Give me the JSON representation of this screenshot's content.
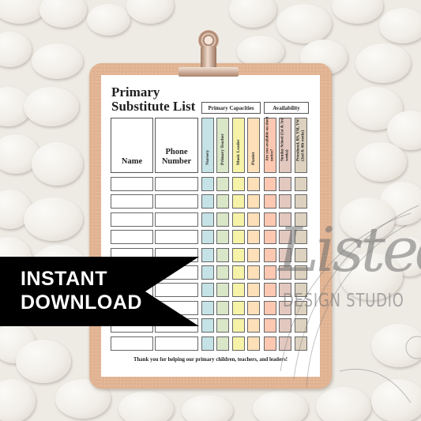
{
  "document": {
    "title_line1": "Primary",
    "title_line2": "Substitute List",
    "groups": {
      "capacities": "Primary Capacities",
      "availability": "Availability"
    },
    "headers": {
      "name": "Name",
      "phone_line1": "Phone",
      "phone_line2": "Number"
    },
    "columns": [
      {
        "label": "Nursery",
        "color": "#c5e3e6"
      },
      {
        "label": "Primary Teacher",
        "color": "#d9e6c8"
      },
      {
        "label": "Music Leader",
        "color": "#f6f3a9"
      },
      {
        "label": "Pianist",
        "color": "#fde0b8"
      },
      {
        "label": "Are you available on short notice?",
        "color": "#fdc8b2"
      },
      {
        "label": "Sunday School (1st & 3rd weeks)",
        "color": "#e2c8bf"
      },
      {
        "label": "Priesthood, RS, YM, YW (2nd & 4th weeks)",
        "color": "#ddd2c0"
      }
    ],
    "row_count": 10,
    "footer": "Thank you for helping our primary children, teachers, and leaders!"
  },
  "banner": {
    "line1": "INSTANT",
    "line2": "DOWNLOAD"
  },
  "watermark": {
    "script": "Listed",
    "studio": "DESIGN STUDIO"
  }
}
